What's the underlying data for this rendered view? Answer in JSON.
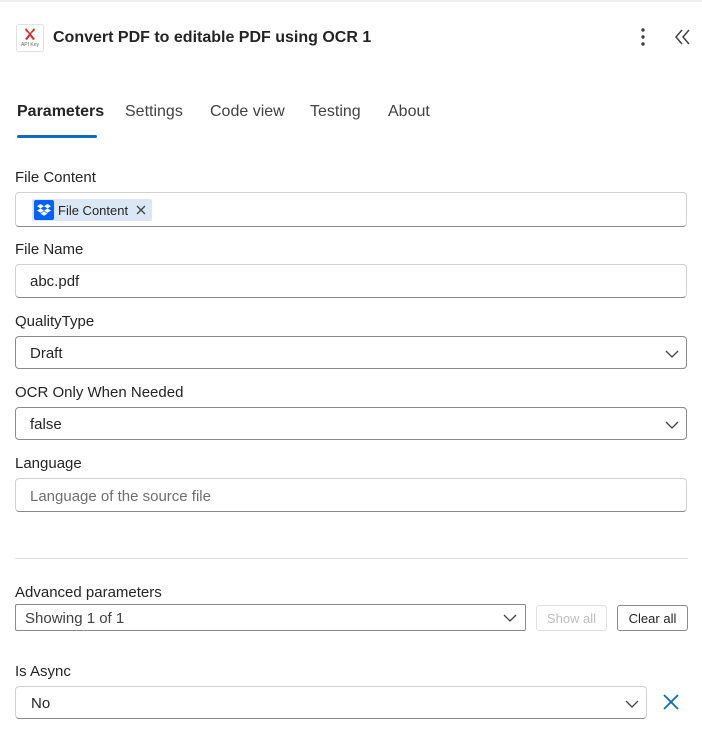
{
  "header": {
    "title": "Convert PDF to editable PDF using OCR 1",
    "app_icon": "api2pdf-logo-icon",
    "app_icon_text": "API Key",
    "more_icon": "more-vertical-icon",
    "collapse_icon": "double-chevron-left-icon"
  },
  "tabs": [
    {
      "label": "Parameters",
      "active": true
    },
    {
      "label": "Settings",
      "active": false
    },
    {
      "label": "Code view",
      "active": false
    },
    {
      "label": "Testing",
      "active": false
    },
    {
      "label": "About",
      "active": false
    }
  ],
  "fields": {
    "file_content": {
      "label": "File Content",
      "token": {
        "label": "File Content",
        "icon": "dropbox-icon",
        "remove_icon": "close-icon"
      }
    },
    "file_name": {
      "label": "File Name",
      "value": "abc.pdf"
    },
    "quality_type": {
      "label": "QualityType",
      "value": "Draft",
      "icon": "chevron-down-icon"
    },
    "ocr_only": {
      "label": "OCR Only When Needed",
      "value": "false",
      "icon": "chevron-down-icon"
    },
    "language": {
      "label": "Language",
      "placeholder": "Language of the source file"
    }
  },
  "advanced": {
    "label": "Advanced parameters",
    "value": "Showing 1 of 1",
    "show_all": "Show all",
    "clear_all": "Clear all"
  },
  "is_async": {
    "label": "Is Async",
    "value": "No",
    "remove_icon": "close-icon"
  },
  "colors": {
    "accent": "#0f6cbd",
    "dropbox": "#0061fe",
    "token_bg": "#dce7f6"
  }
}
